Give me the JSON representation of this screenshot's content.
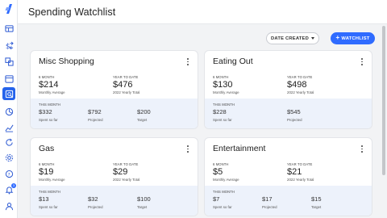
{
  "header": {
    "title": "Spending Watchlist"
  },
  "toolbar": {
    "sort_label": "DATE CREATED",
    "add_label": "WATCHLIST"
  },
  "nav": [
    {
      "icon": "dashboard-icon"
    },
    {
      "icon": "transactions-icon"
    },
    {
      "icon": "accounts-icon"
    },
    {
      "icon": "calendar-icon"
    },
    {
      "icon": "watchlist-icon"
    },
    {
      "icon": "investments-icon"
    },
    {
      "icon": "trends-icon"
    },
    {
      "icon": "recurring-icon"
    },
    {
      "icon": "settings-icon"
    },
    {
      "icon": "help-icon"
    },
    {
      "icon": "notifications-icon",
      "badge": "3"
    },
    {
      "icon": "profile-icon"
    }
  ],
  "labels": {
    "avg_period": "6 MONTH",
    "avg_sub": "Monthly Average",
    "ytd": "YEAR TO DATE",
    "ytd_sub": "2022 Yearly Total",
    "this_month": "THIS MONTH",
    "spent": "Spent so far",
    "projected": "Projected",
    "target": "Target"
  },
  "cards": [
    {
      "name": "Misc Shopping",
      "avg": "$214",
      "ytd": "$476",
      "spent": "$332",
      "projected": "$792",
      "target": "$200"
    },
    {
      "name": "Eating Out",
      "avg": "$130",
      "ytd": "$498",
      "spent": "$228",
      "projected": "$545",
      "target": ""
    },
    {
      "name": "Gas",
      "avg": "$19",
      "ytd": "$29",
      "spent": "$13",
      "projected": "$32",
      "target": "$100"
    },
    {
      "name": "Entertainment",
      "avg": "$5",
      "ytd": "$21",
      "spent": "$7",
      "projected": "$17",
      "target": "$15"
    }
  ],
  "colors": {
    "accent": "#2f6bff",
    "card_bottom": "#edf2fb",
    "active_nav": "#2563eb"
  }
}
